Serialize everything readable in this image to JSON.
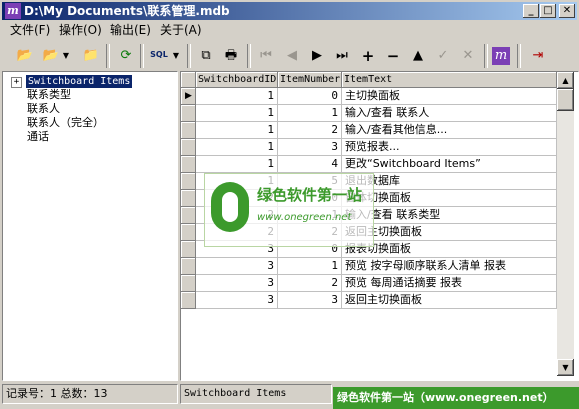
{
  "window": {
    "title": "D:\\My Documents\\联系管理.mdb"
  },
  "menu": [
    "文件(F)",
    "操作(O)",
    "输出(E)",
    "关于(A)"
  ],
  "toolbar": {
    "icons": [
      "open-folder-icon",
      "open-dropdown-icon",
      "folder-icon",
      "refresh-icon",
      "sql-icon",
      "copy-icon",
      "print-icon",
      "first-record-icon",
      "prev-record-icon",
      "next-record-icon",
      "last-record-icon",
      "add-record-icon",
      "delete-record-icon",
      "move-up-icon",
      "confirm-icon",
      "cancel-icon",
      "brand-icon",
      "exit-icon"
    ],
    "sql_label": "SQL"
  },
  "tree": {
    "root": "Switchboard Items",
    "items": [
      "联系类型",
      "联系人",
      "联系人（完全）",
      "通话"
    ]
  },
  "grid": {
    "columns": [
      "SwitchboardID",
      "ItemNumber",
      "ItemText"
    ],
    "rows": [
      [
        "1",
        "0",
        "主切换面板"
      ],
      [
        "1",
        "1",
        "输入/查看 联系人"
      ],
      [
        "1",
        "2",
        "输入/查看其他信息..."
      ],
      [
        "1",
        "3",
        "预览报表..."
      ],
      [
        "1",
        "4",
        "更改“Switchboard Items”"
      ],
      [
        "1",
        "5",
        "退出数据库"
      ],
      [
        "2",
        "0",
        "窗体切换面板"
      ],
      [
        "2",
        "1",
        "输入/查看 联系类型"
      ],
      [
        "2",
        "2",
        "返回主切换面板"
      ],
      [
        "3",
        "0",
        "报表切换面板"
      ],
      [
        "3",
        "1",
        "预览 按字母顺序联系人清单 报表"
      ],
      [
        "3",
        "2",
        "预览 每周通话摘要 报表"
      ],
      [
        "3",
        "3",
        "返回主切换面板"
      ]
    ]
  },
  "watermark": {
    "title": "绿色软件第一站",
    "url": "www.onegreen.net"
  },
  "status": {
    "record_info": "记录号：1 总数：13",
    "table_name": "Switchboard Items",
    "banner": "绿色软件第一站（www.onegreen.net）"
  }
}
